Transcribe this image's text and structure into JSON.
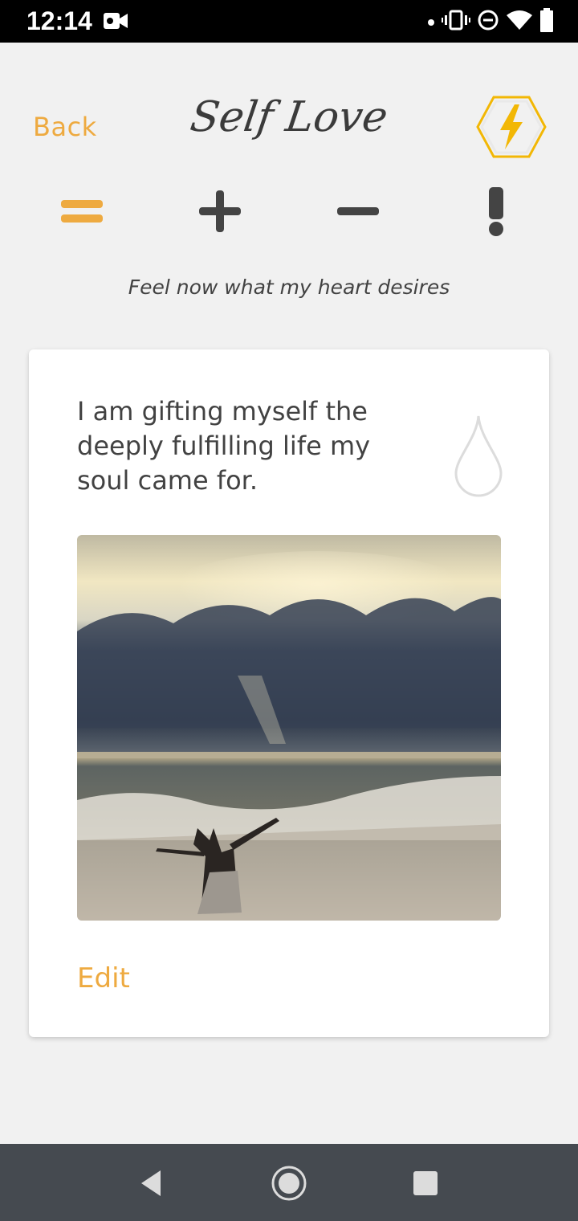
{
  "status_bar": {
    "time": "12:14",
    "icons": [
      "video-camera-icon",
      "dot-icon",
      "vibrate-icon",
      "do-not-disturb-icon",
      "wifi-icon",
      "battery-icon"
    ]
  },
  "header": {
    "back_label": "Back",
    "title": "Self Love",
    "badge_icon": "lightning-bolt-icon"
  },
  "nav": {
    "items": [
      {
        "name": "equals-icon",
        "active": true
      },
      {
        "name": "plus-icon",
        "active": false
      },
      {
        "name": "minus-icon",
        "active": false
      },
      {
        "name": "exclamation-icon",
        "active": false
      }
    ]
  },
  "subtitle": "Feel now what my heart desires",
  "card": {
    "affirmation": "I am gifting myself the deeply fulfilling life my soul came for.",
    "drop_icon": "water-drop-icon",
    "edit_label": "Edit"
  },
  "system_nav": {
    "icons": [
      "back-triangle-icon",
      "home-circle-icon",
      "recents-square-icon"
    ]
  },
  "colors": {
    "accent": "#eeaa40",
    "text_dark": "#424242",
    "background": "#f1f1f1",
    "nav_bar": "#454a50"
  }
}
